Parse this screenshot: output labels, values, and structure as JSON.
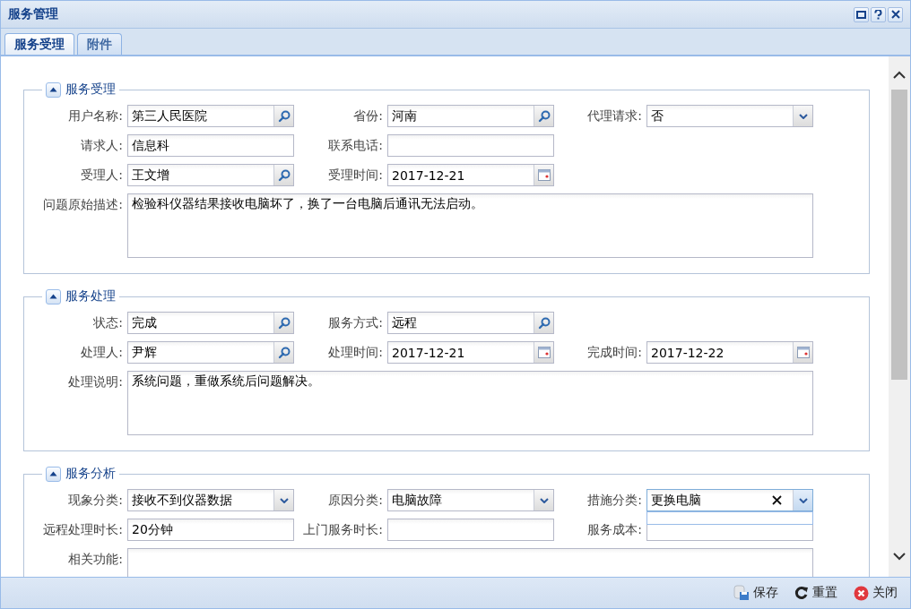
{
  "window": {
    "title": "服务管理"
  },
  "tabs": [
    {
      "label": "服务受理",
      "selected": true
    },
    {
      "label": "附件",
      "selected": false
    }
  ],
  "sections": [
    {
      "title": "服务受理",
      "expanded": true,
      "rows": [
        [
          {
            "label": "用户名称:",
            "value": "第三人民医院",
            "kind": "search",
            "focused": false
          },
          {
            "label": "省份:",
            "value": "河南",
            "kind": "search",
            "focused": false
          },
          {
            "label": "代理请求:",
            "value": "否",
            "kind": "combo",
            "focused": false
          }
        ],
        [
          {
            "label": "请求人:",
            "value": "信息科",
            "kind": "text",
            "focused": false
          },
          {
            "label": "联系电话:",
            "kind": "text",
            "focused": false
          }
        ],
        [
          {
            "label": "受理人:",
            "value": "王文增",
            "kind": "search",
            "focused": false
          },
          {
            "label": "受理时间:",
            "value": "2017-12-21",
            "kind": "date",
            "focused": false
          }
        ],
        [
          {
            "label": "问题原始描述:",
            "value": "检验科仪器结果接收电脑坏了，换了一台电脑后通讯无法启动。",
            "kind": "textarea",
            "focused": false
          }
        ]
      ]
    },
    {
      "title": "服务处理",
      "expanded": true,
      "rows": [
        [
          {
            "label": "状态:",
            "value": "完成",
            "kind": "search",
            "focused": false
          },
          {
            "label": "服务方式:",
            "value": "远程",
            "kind": "search",
            "focused": false
          }
        ],
        [
          {
            "label": "处理人:",
            "value": "尹辉",
            "kind": "search",
            "focused": false
          },
          {
            "label": "处理时间:",
            "value": "2017-12-21",
            "kind": "date",
            "focused": false
          },
          {
            "label": "完成时间:",
            "value": "2017-12-22",
            "kind": "date",
            "focused": false
          }
        ],
        [
          {
            "label": "处理说明:",
            "value": "系统问题，重做系统后问题解决。",
            "kind": "textarea",
            "focused": false
          }
        ]
      ]
    },
    {
      "title": "服务分析",
      "expanded": true,
      "rows": [
        [
          {
            "label": "现象分类:",
            "value": "接收不到仪器数据",
            "kind": "combo",
            "focused": false
          },
          {
            "label": "原因分类:",
            "value": "电脑故障",
            "kind": "combo",
            "focused": false
          },
          {
            "label": "措施分类:",
            "value": "更换电脑",
            "kind": "combo",
            "focused": true
          }
        ],
        [
          {
            "label": "远程处理时长:",
            "value": "20分钟",
            "kind": "text",
            "focused": false
          },
          {
            "label": "上门服务时长:",
            "kind": "text",
            "focused": false
          },
          {
            "label": "服务成本:",
            "kind": "text",
            "focused": false
          }
        ],
        [
          {
            "label": "相关功能:",
            "kind": "textarea",
            "focused": false
          }
        ]
      ]
    }
  ],
  "buttons": [
    {
      "label": "保存",
      "kind": "save"
    },
    {
      "label": "重置",
      "kind": "reset"
    },
    {
      "label": "关闭",
      "kind": "close"
    }
  ]
}
